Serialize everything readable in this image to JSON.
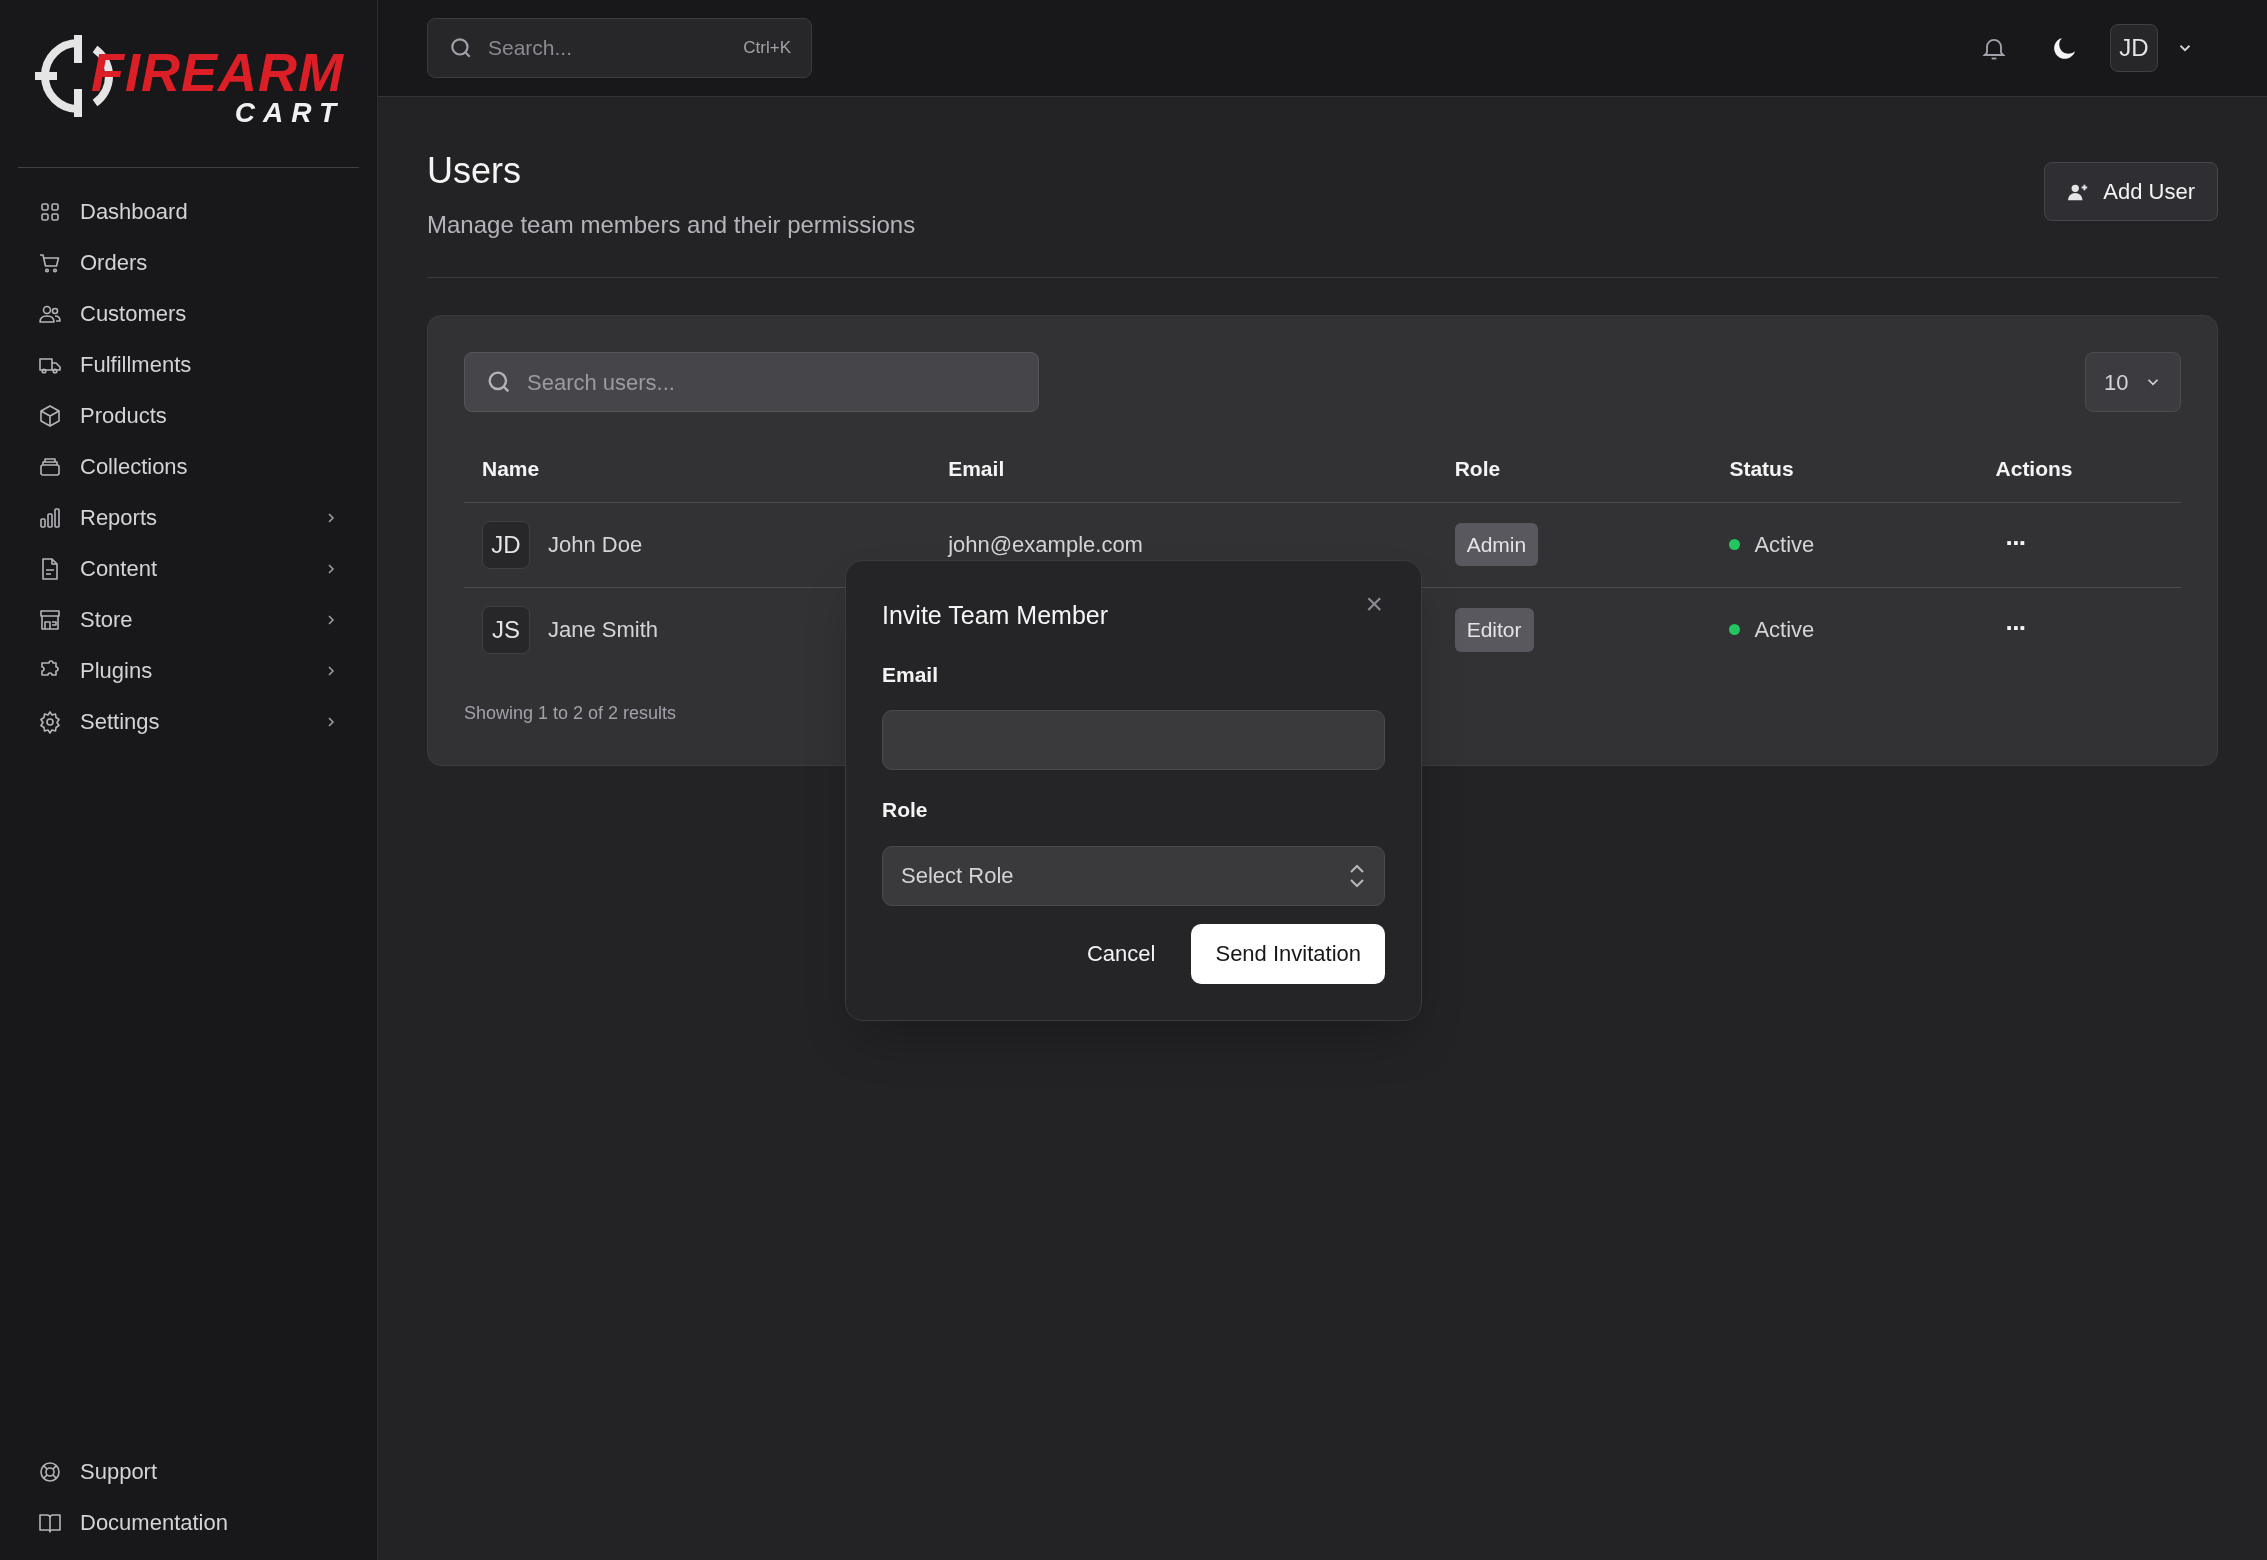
{
  "logo": {
    "word": "FIREARM",
    "sub": "CART"
  },
  "sidebar": {
    "items": [
      {
        "label": "Dashboard",
        "expandable": false
      },
      {
        "label": "Orders",
        "expandable": false
      },
      {
        "label": "Customers",
        "expandable": false
      },
      {
        "label": "Fulfillments",
        "expandable": false
      },
      {
        "label": "Products",
        "expandable": false
      },
      {
        "label": "Collections",
        "expandable": false
      },
      {
        "label": "Reports",
        "expandable": true
      },
      {
        "label": "Content",
        "expandable": true
      },
      {
        "label": "Store",
        "expandable": true
      },
      {
        "label": "Plugins",
        "expandable": true
      },
      {
        "label": "Settings",
        "expandable": true
      }
    ],
    "footer": [
      {
        "label": "Support"
      },
      {
        "label": "Documentation"
      }
    ]
  },
  "header": {
    "search": {
      "placeholder": "Search...",
      "shortcut": "Ctrl+K"
    },
    "user": "JD"
  },
  "page": {
    "title": "Users",
    "subtitle": "Manage team members and their permissions",
    "add_button": "Add User"
  },
  "table": {
    "search": {
      "placeholder": "Search users..."
    },
    "page_size": "10",
    "columns": [
      "Name",
      "Email",
      "Role",
      "Status",
      "Actions"
    ],
    "rows": [
      {
        "initials": "JD",
        "name": "John Doe",
        "email": "john@example.com",
        "role": "Admin",
        "status": "Active",
        "color": "#22c55e",
        "actions": "···"
      },
      {
        "initials": "JS",
        "name": "Jane Smith",
        "role": "Editor",
        "status": "Active",
        "color": "#22c55e",
        "actions": "···"
      }
    ],
    "footer": "Showing 1 to 2 of 2 results"
  },
  "dialog": {
    "title": "Invite Team Member",
    "close": "×",
    "email_label": "Email",
    "role_label": "Role",
    "role_placeholder": "Select Role",
    "cancel": "Cancel",
    "submit": "Send Invitation"
  }
}
